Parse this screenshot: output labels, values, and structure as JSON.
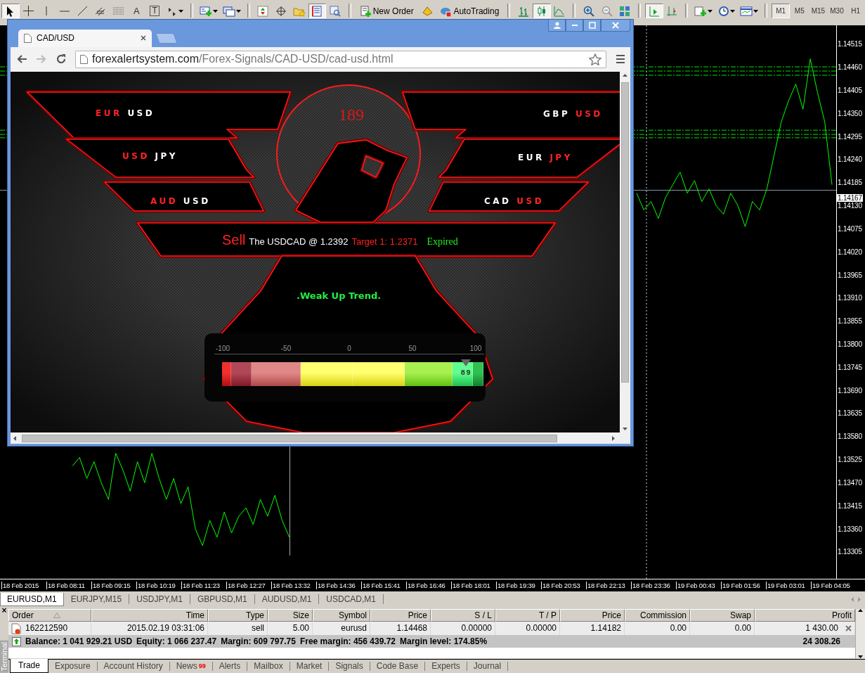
{
  "toolbar": {
    "items": [
      {
        "kind": "tool",
        "selected": true
      },
      {
        "kind": "tool",
        "selected": false
      },
      {
        "kind": "tool",
        "selected": false
      },
      {
        "kind": "tool",
        "selected": false
      },
      {
        "kind": "tool",
        "selected": false
      },
      {
        "kind": "tool",
        "selected": false
      },
      {
        "kind": "tool",
        "selected": false
      },
      {
        "kind": "tool",
        "selected": false,
        "glyph": "A"
      },
      {
        "kind": "tool",
        "selected": false,
        "glyph": "T"
      },
      {
        "kind": "tool",
        "selected": false
      },
      {
        "kind": "tool",
        "selected": false
      },
      {
        "kind": "tool",
        "selected": false
      },
      {
        "kind": "tool",
        "selected": false
      },
      {
        "kind": "tool",
        "selected": false
      },
      {
        "kind": "tool",
        "selected": false
      },
      {
        "kind": "tool",
        "selected": true
      },
      {
        "kind": "tool",
        "selected": false
      },
      {
        "kind": "button",
        "label": "New Order"
      },
      {
        "kind": "tool",
        "selected": false
      },
      {
        "kind": "button",
        "label": "AutoTrading"
      },
      {
        "kind": "tool",
        "selected": false
      },
      {
        "kind": "tool",
        "selected": true
      },
      {
        "kind": "tool",
        "selected": false
      },
      {
        "kind": "tool",
        "selected": false
      },
      {
        "kind": "tool",
        "selected": false
      },
      {
        "kind": "tool",
        "selected": false
      },
      {
        "kind": "tool",
        "selected": true
      },
      {
        "kind": "tool",
        "selected": false
      },
      {
        "kind": "tool",
        "selected": false
      },
      {
        "kind": "tool",
        "selected": false
      },
      {
        "kind": "tool",
        "selected": false
      }
    ],
    "timeframes": [
      {
        "label": "M1",
        "selected": true
      },
      {
        "label": "M5",
        "selected": false
      },
      {
        "label": "M15",
        "selected": false
      },
      {
        "label": "M30",
        "selected": false
      },
      {
        "label": "H1",
        "selected": false
      }
    ]
  },
  "chart": {
    "chart_data": {
      "type": "line",
      "ylim": [
        1.13241,
        1.1456
      ],
      "grid": false,
      "ref_lines": [
        {
          "axis": "y",
          "value": 1.14461,
          "color": "#00e000"
        },
        {
          "axis": "y",
          "value": 1.14451,
          "color": "#00e000"
        },
        {
          "axis": "y",
          "value": 1.14441,
          "color": "#00e000"
        },
        {
          "axis": "y",
          "value": 1.1431,
          "color": "#00e000"
        },
        {
          "axis": "y",
          "value": 1.143,
          "color": "#00e000"
        },
        {
          "axis": "y",
          "value": 1.14292,
          "color": "#00e000"
        },
        {
          "axis": "y",
          "value": 1.14167,
          "color": "#8896a8"
        }
      ],
      "yticks": [
        {
          "value": 1.14515,
          "label": "1.14515"
        },
        {
          "value": 1.1446,
          "label": "1.14460"
        },
        {
          "value": 1.14405,
          "label": "1.14405"
        },
        {
          "value": 1.1435,
          "label": "1.14350"
        },
        {
          "value": 1.14295,
          "label": "1.14295"
        },
        {
          "value": 1.1424,
          "label": "1.14240"
        },
        {
          "value": 1.14185,
          "label": "1.14185"
        },
        {
          "value": 1.1413,
          "label": "1.14130"
        },
        {
          "value": 1.14075,
          "label": "1.14075"
        },
        {
          "value": 1.1402,
          "label": "1.14020"
        },
        {
          "value": 1.13965,
          "label": "1.13965"
        },
        {
          "value": 1.1391,
          "label": "1.13910"
        },
        {
          "value": 1.13855,
          "label": "1.13855"
        },
        {
          "value": 1.138,
          "label": "1.13800"
        },
        {
          "value": 1.13745,
          "label": "1.13745"
        },
        {
          "value": 1.1369,
          "label": "1.13690"
        },
        {
          "value": 1.13635,
          "label": "1.13635"
        },
        {
          "value": 1.1358,
          "label": "1.13580"
        },
        {
          "value": 1.13525,
          "label": "1.13525"
        },
        {
          "value": 1.1347,
          "label": "1.13470"
        },
        {
          "value": 1.13415,
          "label": "1.13415"
        },
        {
          "value": 1.1336,
          "label": "1.13360"
        },
        {
          "value": 1.13305,
          "label": "1.13305"
        }
      ],
      "series": [
        {
          "color": "#00ff00",
          "values": [
            null,
            null,
            null,
            null,
            null,
            null,
            null,
            null,
            null,
            null,
            1.1351,
            1.1353,
            1.1348,
            1.1352,
            1.1347,
            1.1343,
            1.1354,
            1.135,
            1.1345,
            1.1352,
            1.1347,
            1.1354,
            1.1348,
            1.1343,
            1.1348,
            1.1342,
            1.1346,
            1.1336,
            1.1332,
            1.1338,
            1.1334,
            1.134,
            1.1335,
            1.1339,
            1.1341,
            1.1337,
            1.1343,
            1.1339,
            1.1344,
            1.1338,
            1.1334,
            null,
            null,
            null,
            null,
            null,
            null,
            null,
            null,
            null,
            null,
            null,
            null,
            null,
            null,
            null,
            null,
            null,
            null,
            null,
            null,
            null,
            null,
            null,
            null,
            null,
            null,
            null,
            null,
            null,
            null,
            null,
            null,
            null,
            null,
            null,
            null,
            null,
            null,
            null,
            null,
            null,
            null,
            null,
            null,
            null,
            null,
            null,
            1.1416,
            1.1412,
            1.1414,
            1.141,
            1.1415,
            1.1418,
            1.1421,
            1.1416,
            1.1419,
            1.1414,
            1.1417,
            1.1413,
            1.1411,
            1.1416,
            1.1413,
            1.1408,
            1.1414,
            1.1412,
            1.1417,
            1.1425,
            1.1433,
            1.1438,
            1.1442,
            1.1436,
            1.1448,
            1.144,
            1.1433,
            1.1418
          ]
        }
      ]
    },
    "current_price": "1.14167",
    "time_labels": [
      "18 Feb 2015",
      "18 Feb 08:11",
      "18 Feb 09:15",
      "18 Feb 10:19",
      "18 Feb 11:23",
      "18 Feb 12:27",
      "18 Feb 13:32",
      "18 Feb 14:36",
      "18 Feb 15:41",
      "18 Feb 16:46",
      "18 Feb 18:01",
      "18 Feb 19:39",
      "18 Feb 20:53",
      "18 Feb 22:13",
      "18 Feb 23:36",
      "19 Feb 00:43",
      "19 Feb 01:56",
      "19 Feb 03:01",
      "19 Feb 04:05"
    ]
  },
  "browser": {
    "tabs": [
      {
        "title": "CAD/USD",
        "selected": true
      }
    ],
    "url": {
      "host": "forexalertsystem.com",
      "path": "/Forex-Signals/CAD-USD/cad-usd.html"
    },
    "board": {
      "number": "189",
      "left_pairs": [
        {
          "base": "EUR",
          "quote": "USD",
          "base_highlighted": true
        },
        {
          "base": "USD",
          "quote": "JPY",
          "base_highlighted": true
        },
        {
          "base": "AUD",
          "quote": "USD",
          "base_highlighted": true
        }
      ],
      "right_pairs": [
        {
          "base": "GBP",
          "quote": "USD",
          "base_highlighted": false
        },
        {
          "base": "EUR",
          "quote": "JPY",
          "base_highlighted": false
        },
        {
          "base": "CAD",
          "quote": "USD",
          "base_highlighted": false
        }
      ],
      "signal": {
        "action": "Sell",
        "text": "The USDCAD @ 1.2392",
        "target": "Target 1: 1.2371",
        "status": "Expired"
      },
      "trend": ".Weak Up Trend.",
      "gauge": {
        "ticks": [
          "-100",
          "-50",
          "0",
          "50",
          "100"
        ],
        "level": 0.945,
        "reading": "89"
      }
    }
  },
  "symbol_tabs": [
    {
      "label": "EURUSD,M1",
      "selected": true
    },
    {
      "label": "EURJPY,M15",
      "selected": false
    },
    {
      "label": "USDJPY,M1",
      "selected": false
    },
    {
      "label": "GBPUSD,M1",
      "selected": false
    },
    {
      "label": "AUDUSD,M1",
      "selected": false
    },
    {
      "label": "USDCAD,M1",
      "selected": false
    }
  ],
  "terminal": {
    "close_glyph": "×",
    "title": "Terminal",
    "columns": [
      {
        "label": "Order",
        "sorted": true
      },
      {
        "label": "Time",
        "sorted": false
      },
      {
        "label": "Type",
        "sorted": false
      },
      {
        "label": "Size",
        "sorted": false
      },
      {
        "label": "Symbol",
        "sorted": false
      },
      {
        "label": "Price",
        "sorted": false
      },
      {
        "label": "S / L",
        "sorted": false
      },
      {
        "label": "T / P",
        "sorted": false
      },
      {
        "label": "Price",
        "sorted": false
      },
      {
        "label": "Commission",
        "sorted": false
      },
      {
        "label": "Swap",
        "sorted": false
      },
      {
        "label": "Profit",
        "sorted": false
      }
    ],
    "rows": [
      {
        "cells": [
          "162212590",
          "2015.02.19 03:31:06",
          "sell",
          "5.00",
          "eurusd",
          "1.14468",
          "0.00000",
          "0.00000",
          "1.14182",
          "0.00",
          "0.00",
          "1 430.00"
        ]
      }
    ],
    "summary": {
      "items": [
        "Balance: 1 041 929.21 USD",
        "Equity: 1 066 237.47",
        "Margin: 609 797.75",
        "Free margin: 456 439.72",
        "Margin level: 174.85%"
      ],
      "total": "24 308.26"
    },
    "tabs": [
      {
        "label": "Trade",
        "selected": true
      },
      {
        "label": "Exposure",
        "selected": false
      },
      {
        "label": "Account History",
        "selected": false
      },
      {
        "label": "News",
        "selected": false,
        "badge": "99"
      },
      {
        "label": "Alerts",
        "selected": false
      },
      {
        "label": "Mailbox",
        "selected": false
      },
      {
        "label": "Market",
        "selected": false
      },
      {
        "label": "Signals",
        "selected": false
      },
      {
        "label": "Code Base",
        "selected": false
      },
      {
        "label": "Experts",
        "selected": false
      },
      {
        "label": "Journal",
        "selected": false
      }
    ]
  }
}
